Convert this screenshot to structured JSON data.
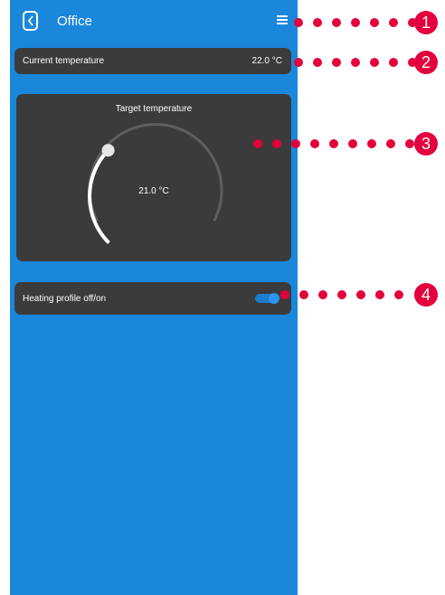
{
  "header": {
    "title": "Office"
  },
  "current": {
    "label": "Current temperature",
    "value": "22.0 °C"
  },
  "target": {
    "label": "Target temperature",
    "value": "21.0 °C",
    "level": 0.33
  },
  "heating": {
    "label": "Heating profile off/on",
    "state": "on"
  },
  "callouts": [
    "1",
    "2",
    "3",
    "4"
  ],
  "colors": {
    "background": "#1a87db",
    "card": "#3b3b3b",
    "callout": "#e3003c",
    "toggle": "#2b95f0"
  }
}
